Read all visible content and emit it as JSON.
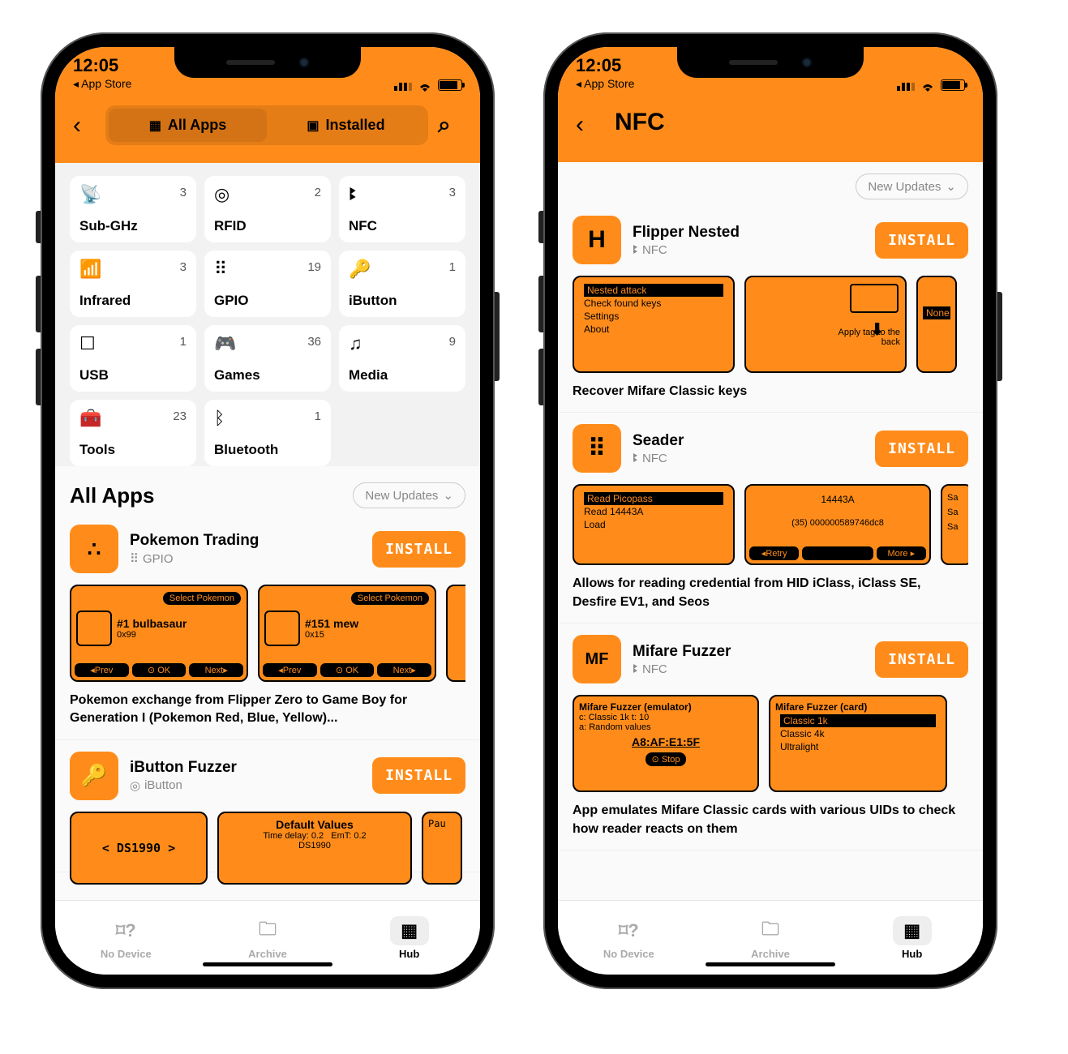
{
  "status": {
    "time": "12:05",
    "back_app": "◂ App Store"
  },
  "left": {
    "tabs": {
      "all": "All Apps",
      "installed": "Installed"
    },
    "categories": [
      {
        "icon": "📡",
        "label": "Sub-GHz",
        "count": 3
      },
      {
        "icon": "◎",
        "label": "RFID",
        "count": 2
      },
      {
        "icon": "ꔪ",
        "label": "NFC",
        "count": 3
      },
      {
        "icon": "📶",
        "label": "Infrared",
        "count": 3
      },
      {
        "icon": "⠿",
        "label": "GPIO",
        "count": 19
      },
      {
        "icon": "🔑",
        "label": "iButton",
        "count": 1
      },
      {
        "icon": "☐",
        "label": "USB",
        "count": 1
      },
      {
        "icon": "🎮",
        "label": "Games",
        "count": 36
      },
      {
        "icon": "♫",
        "label": "Media",
        "count": 9
      },
      {
        "icon": "🧰",
        "label": "Tools",
        "count": 23
      },
      {
        "icon": "ᛒ",
        "label": "Bluetooth",
        "count": 1
      }
    ],
    "section_title": "All Apps",
    "filter_label": "New Updates",
    "apps": [
      {
        "icon": "∴",
        "name": "Pokemon Trading",
        "cat_icon": "⠿",
        "cat": "GPIO",
        "install": "INSTALL",
        "shots": [
          {
            "sel": "Select Pokemon",
            "big": "#1 bulbasaur",
            "sub": "0x99",
            "btns": [
              "◂Prev",
              "⊙ OK",
              "Next▸"
            ]
          },
          {
            "sel": "Select Pokemon",
            "big": "#151 mew",
            "sub": "0x15",
            "btns": [
              "◂Prev",
              "⊙ OK",
              "Next▸"
            ]
          }
        ],
        "desc": "Pokemon exchange from Flipper Zero to Game Boy for Generation I (Pokemon Red, Blue, Yellow)..."
      },
      {
        "icon": "🔑",
        "name": "iButton Fuzzer",
        "cat_icon": "◎",
        "cat": "iButton",
        "install": "INSTALL",
        "shots": [
          {
            "txt": "<  DS1990  >"
          },
          {
            "title": "Default Values",
            "l1": "Time delay: 0.2",
            "l2": "EmT: 0.2",
            "l3": "DS1990"
          },
          {
            "txt": "Pau"
          }
        ]
      }
    ]
  },
  "right": {
    "title": "NFC",
    "filter_label": "New Updates",
    "apps": [
      {
        "iconText": "H",
        "name": "Flipper Nested",
        "cat_icon": "ꔪ",
        "cat": "NFC",
        "install": "INSTALL",
        "shot_menu": [
          "Nested attack",
          "Check found keys",
          "Settings",
          "About"
        ],
        "shot2_text": "Apply tag to the back",
        "shot3_text": "None",
        "desc": "Recover Mifare Classic keys"
      },
      {
        "iconText": "⠿",
        "name": "Seader",
        "cat_icon": "ꔪ",
        "cat": "NFC",
        "install": "INSTALL",
        "shot_menu": [
          "Read Picopass",
          "Read 14443A",
          "Load"
        ],
        "shot2_top": "14443A",
        "shot2_mid": "(35) 000000589746dc8",
        "shot2_b1": "◂Retry",
        "shot2_b2": "More ▸",
        "shot3": [
          "Sa",
          "Sa",
          "Sa"
        ],
        "desc": "Allows for reading credential from HID iClass, iClass SE, Desfire EV1, and Seos"
      },
      {
        "iconText": "MF",
        "name": "Mifare Fuzzer",
        "cat_icon": "ꔪ",
        "cat": "NFC",
        "install": "INSTALL",
        "shot1_title": "Mifare Fuzzer (emulator)",
        "shot1_l1": "c: Classic 1k    t: 10",
        "shot1_l2": "a: Random values",
        "shot1_uid": "A8:AF:E1:5F",
        "shot1_btn": "⊙ Stop",
        "shot2_title": "Mifare Fuzzer (card)",
        "shot2_menu": [
          "Classic 1k",
          "Classic 4k",
          "Ultralight"
        ],
        "desc": "App emulates Mifare Classic cards with various UIDs to check how reader reacts on them"
      }
    ]
  },
  "tabs": {
    "nodevice": "No Device",
    "archive": "Archive",
    "hub": "Hub"
  }
}
